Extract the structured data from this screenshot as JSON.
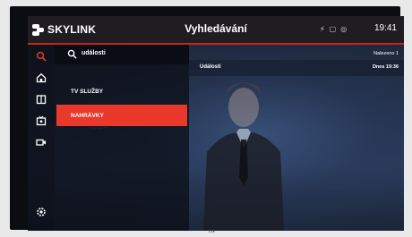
{
  "header": {
    "brand": "SKYLINK",
    "title": "Vyhledávání",
    "time": "19:41",
    "status_icons": [
      "bolt-icon",
      "screen-icon",
      "record-icon"
    ]
  },
  "sidebar": {
    "items": [
      {
        "icon": "search-icon",
        "active": true
      },
      {
        "icon": "home-icon",
        "active": false
      },
      {
        "icon": "book-icon",
        "active": false
      },
      {
        "icon": "tv-guide-icon",
        "active": false
      },
      {
        "icon": "camera-icon",
        "active": false
      }
    ],
    "bottom": {
      "icon": "settings-icon"
    }
  },
  "search": {
    "query": "události",
    "categories": [
      {
        "label": "TV SLUŽBY",
        "active": false
      },
      {
        "label": "NAHRÁVKY",
        "active": true
      }
    ]
  },
  "results": {
    "count_label": "Nalezeno 1",
    "items": [
      {
        "title": "Události",
        "date": "Dnes 19:36"
      }
    ]
  },
  "tv_brand": "LG",
  "colors": {
    "accent": "#e8392a",
    "topbar": "#1f1d22",
    "divider": "#c4261d"
  }
}
